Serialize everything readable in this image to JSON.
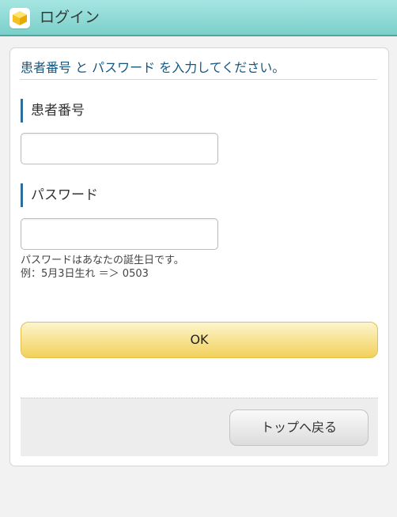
{
  "header": {
    "title": "ログイン",
    "icon": "cube-icon"
  },
  "form": {
    "instruction": "患者番号 と パスワード を入力してください。",
    "patient_number": {
      "label": "患者番号",
      "value": "",
      "placeholder": ""
    },
    "password": {
      "label": "パスワード",
      "value": "",
      "placeholder": "",
      "help_line1": "パスワードはあなたの誕生日です。",
      "help_line2": "例：5月3日生れ ＝＞ 0503"
    },
    "ok_label": "OK",
    "back_label": "トップへ戻る"
  },
  "colors": {
    "header_bg": "#90dbd7",
    "instruction_text": "#16567e",
    "label_accent": "#2f6e9a",
    "ok_button": "#f2d05a"
  }
}
